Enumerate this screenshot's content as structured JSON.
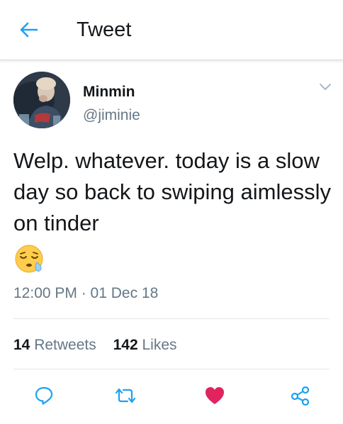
{
  "header": {
    "title": "Tweet",
    "back_icon": "arrow-left-icon"
  },
  "tweet": {
    "author": {
      "display_name": "Minmin",
      "handle": "@jiminie"
    },
    "text": "Welp. whatever. today is a slow day so back to swiping aimlessly on tinder",
    "emoji": "sleepy-face-emoji",
    "timestamp": "12:00 PM · 01 Dec 18",
    "stats": {
      "retweets_count": "14",
      "retweets_label": "Retweets",
      "likes_count": "142",
      "likes_label": "Likes"
    },
    "liked": true
  },
  "actions": [
    {
      "icon": "reply-icon"
    },
    {
      "icon": "retweet-icon"
    },
    {
      "icon": "heart-icon"
    },
    {
      "icon": "share-icon"
    }
  ],
  "colors": {
    "accent": "#1da1f2",
    "like_active": "#e0245e",
    "secondary_text": "#657786",
    "primary_text": "#14171a",
    "divider": "#e1e8ed"
  }
}
